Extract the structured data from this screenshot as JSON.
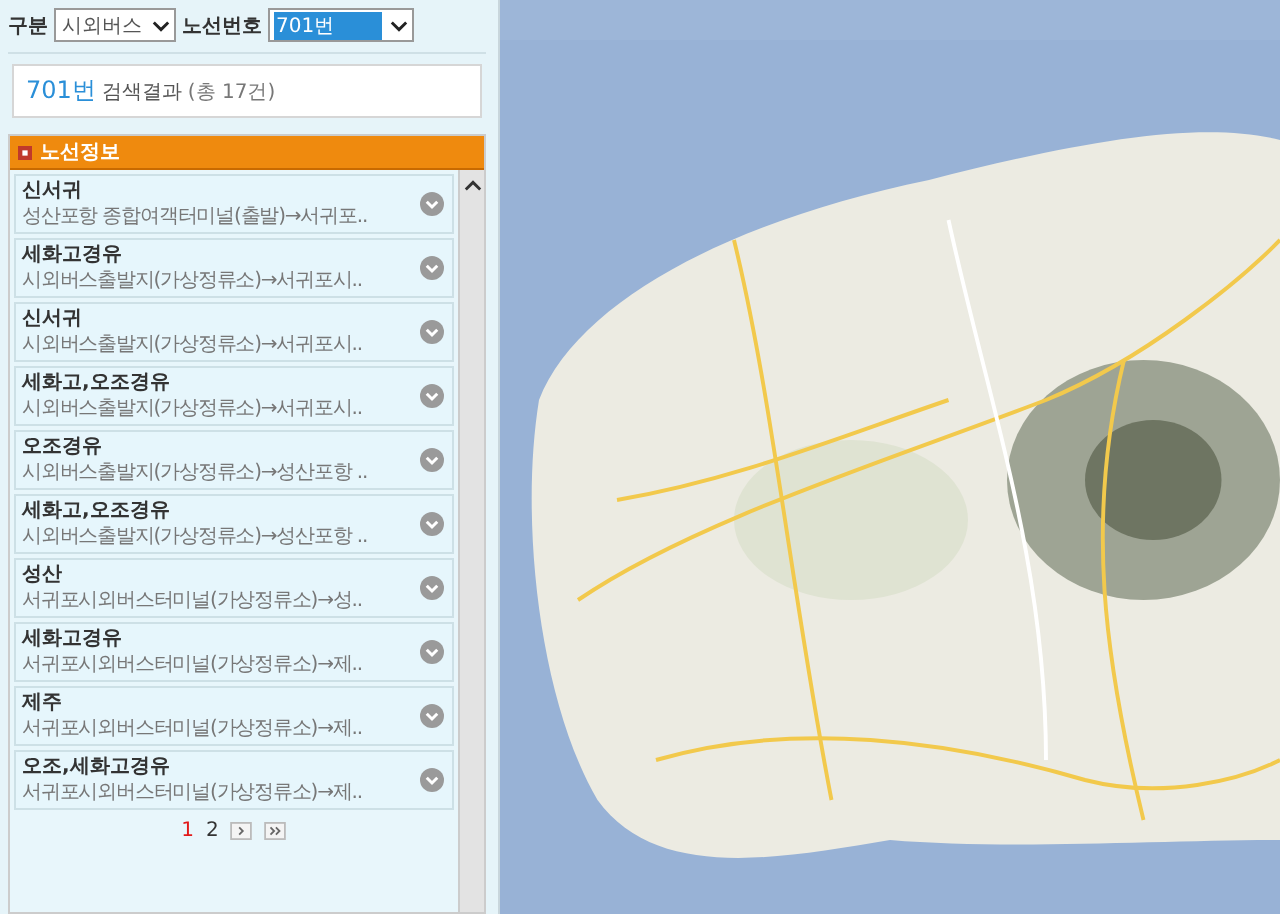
{
  "filter": {
    "category_label": "구분",
    "category_value": "시외버스",
    "route_label": "노선번호",
    "route_value": "701번"
  },
  "result": {
    "route": "701번",
    "label": "검색결과",
    "count": "(총 17건)"
  },
  "panel": {
    "title": "노선정보"
  },
  "routes": [
    {
      "name": "신서귀",
      "description": "성산포항 종합여객터미널(출발)→서귀포.."
    },
    {
      "name": "세화고경유",
      "description": "시외버스출발지(가상정류소)→서귀포시.."
    },
    {
      "name": "신서귀",
      "description": "시외버스출발지(가상정류소)→서귀포시.."
    },
    {
      "name": "세화고,오조경유",
      "description": "시외버스출발지(가상정류소)→서귀포시.."
    },
    {
      "name": "오조경유",
      "description": "시외버스출발지(가상정류소)→성산포항 .."
    },
    {
      "name": "세화고,오조경유",
      "description": "시외버스출발지(가상정류소)→성산포항 .."
    },
    {
      "name": "성산",
      "description": "서귀포시외버스터미널(가상정류소)→성.."
    },
    {
      "name": "세화고경유",
      "description": "서귀포시외버스터미널(가상정류소)→제.."
    },
    {
      "name": "제주",
      "description": "서귀포시외버스터미널(가상정류소)→제.."
    },
    {
      "name": "오조,세화고경유",
      "description": "서귀포시외버스터미널(가상정류소)→제.."
    }
  ],
  "pagination": [
    {
      "label": "1",
      "selected": true
    },
    {
      "label": "2",
      "selected": false
    }
  ]
}
